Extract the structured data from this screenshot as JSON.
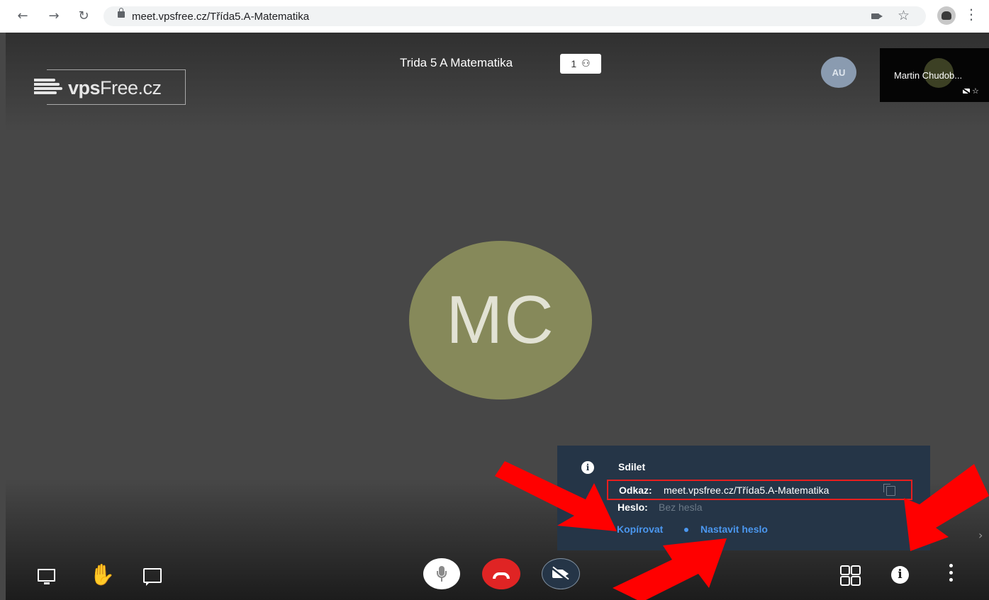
{
  "browser": {
    "url": "meet.vpsfree.cz/Třída5.A-Matematika"
  },
  "logo": {
    "text_bold": "vps",
    "text_light": "Free.cz"
  },
  "meeting": {
    "title": "Trida 5 A Matematika",
    "participant_count": "1"
  },
  "participants": {
    "au_initials": "AU",
    "thumbnail_name": "Martin Chudob...",
    "main_initials": "MC"
  },
  "info_panel": {
    "title": "Sdilet",
    "link_label": "Odkaz:",
    "link_value": "meet.vpsfree.cz/Třída5.A-Matematika",
    "password_label": "Heslo:",
    "password_value": "Bez hesla",
    "copy_action": "Kopírovat",
    "set_password_action": "Nastavit heslo"
  },
  "colors": {
    "stage_bg": "#474747",
    "panel_bg": "#253547",
    "link_blue": "#4b97ef",
    "hangup_red": "#e02424",
    "highlight_red": "#e81e1e",
    "avatar_main": "#86895a"
  },
  "icons": {
    "toolbar_left": [
      "screen-share-icon",
      "raise-hand-icon",
      "chat-icon"
    ],
    "toolbar_center": [
      "microphone-icon",
      "hangup-icon",
      "camera-off-icon"
    ],
    "toolbar_right": [
      "tile-view-icon",
      "info-icon",
      "more-options-icon"
    ]
  }
}
